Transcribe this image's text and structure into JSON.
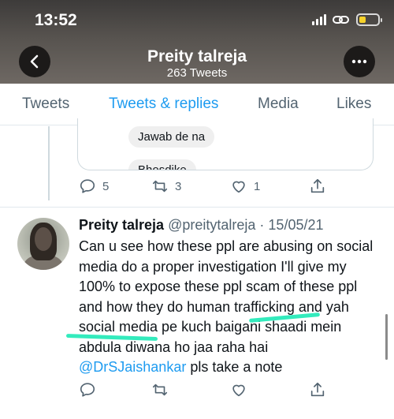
{
  "status_bar": {
    "time": "13:52"
  },
  "header": {
    "title": "Preity talreja",
    "subtitle": "263 Tweets"
  },
  "tabs": [
    {
      "label": "Tweets",
      "active": false
    },
    {
      "label": "Tweets & replies",
      "active": true
    },
    {
      "label": "Media",
      "active": false
    },
    {
      "label": "Likes",
      "active": false
    }
  ],
  "quoted_thread": {
    "messages": [
      "Jawab de na",
      "Bhosdike"
    ]
  },
  "first_tweet_actions": {
    "replies": "5",
    "retweets": "3",
    "likes": "1"
  },
  "tweet": {
    "name": "Preity talreja",
    "handle": "@preitytalreja",
    "date": "· 15/05/21",
    "text_main": "Can u see how these ppl are abusing on social media do a proper investigation I'll give my 100% to expose these ppl scam of these ppl and how they do human trafficking and yah social media pe kuch baigani shaadi mein abdula diwana ho jaa raha hai ",
    "mention": "@DrSJaishankar",
    "text_tail": "  pls take a note"
  },
  "colors": {
    "accent": "#1d9bf0",
    "highlight": "#1de9b6",
    "battery": "#f6d22a"
  },
  "icons": [
    "back-arrow-icon",
    "more-icon",
    "reply-icon",
    "retweet-icon",
    "like-icon",
    "share-icon",
    "wifi-link-icon"
  ]
}
